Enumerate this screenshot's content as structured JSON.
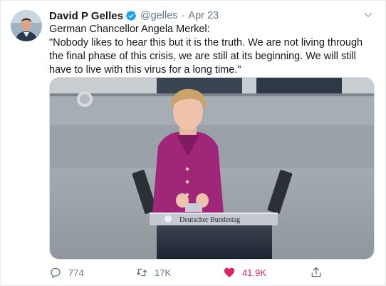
{
  "tweet": {
    "author_name": "David P Gelles",
    "handle": "@gelles",
    "separator": "·",
    "timestamp": "Apr 23",
    "text_line1": "German Chancellor Angela Merkel:",
    "text_line2": "\"Nobody likes to hear this but it is the truth. We are not living through the final phase of this crisis, we are still at its beginning. We will still have to live with this virus for a long time.\"",
    "media": {
      "podium_label": "Deutscher Bundestag"
    }
  },
  "actions": {
    "replies": "774",
    "retweets": "17K",
    "likes": "41.9K"
  },
  "icons": {
    "verified": "verified-badge-icon",
    "caret": "chevron-down-icon",
    "reply": "reply-icon",
    "retweet": "retweet-icon",
    "like": "heart-icon",
    "share": "share-icon"
  },
  "colors": {
    "accent": "#1da1f2",
    "like": "#e0245e",
    "secondary_text": "#657786",
    "jacket": "#a0267a"
  }
}
